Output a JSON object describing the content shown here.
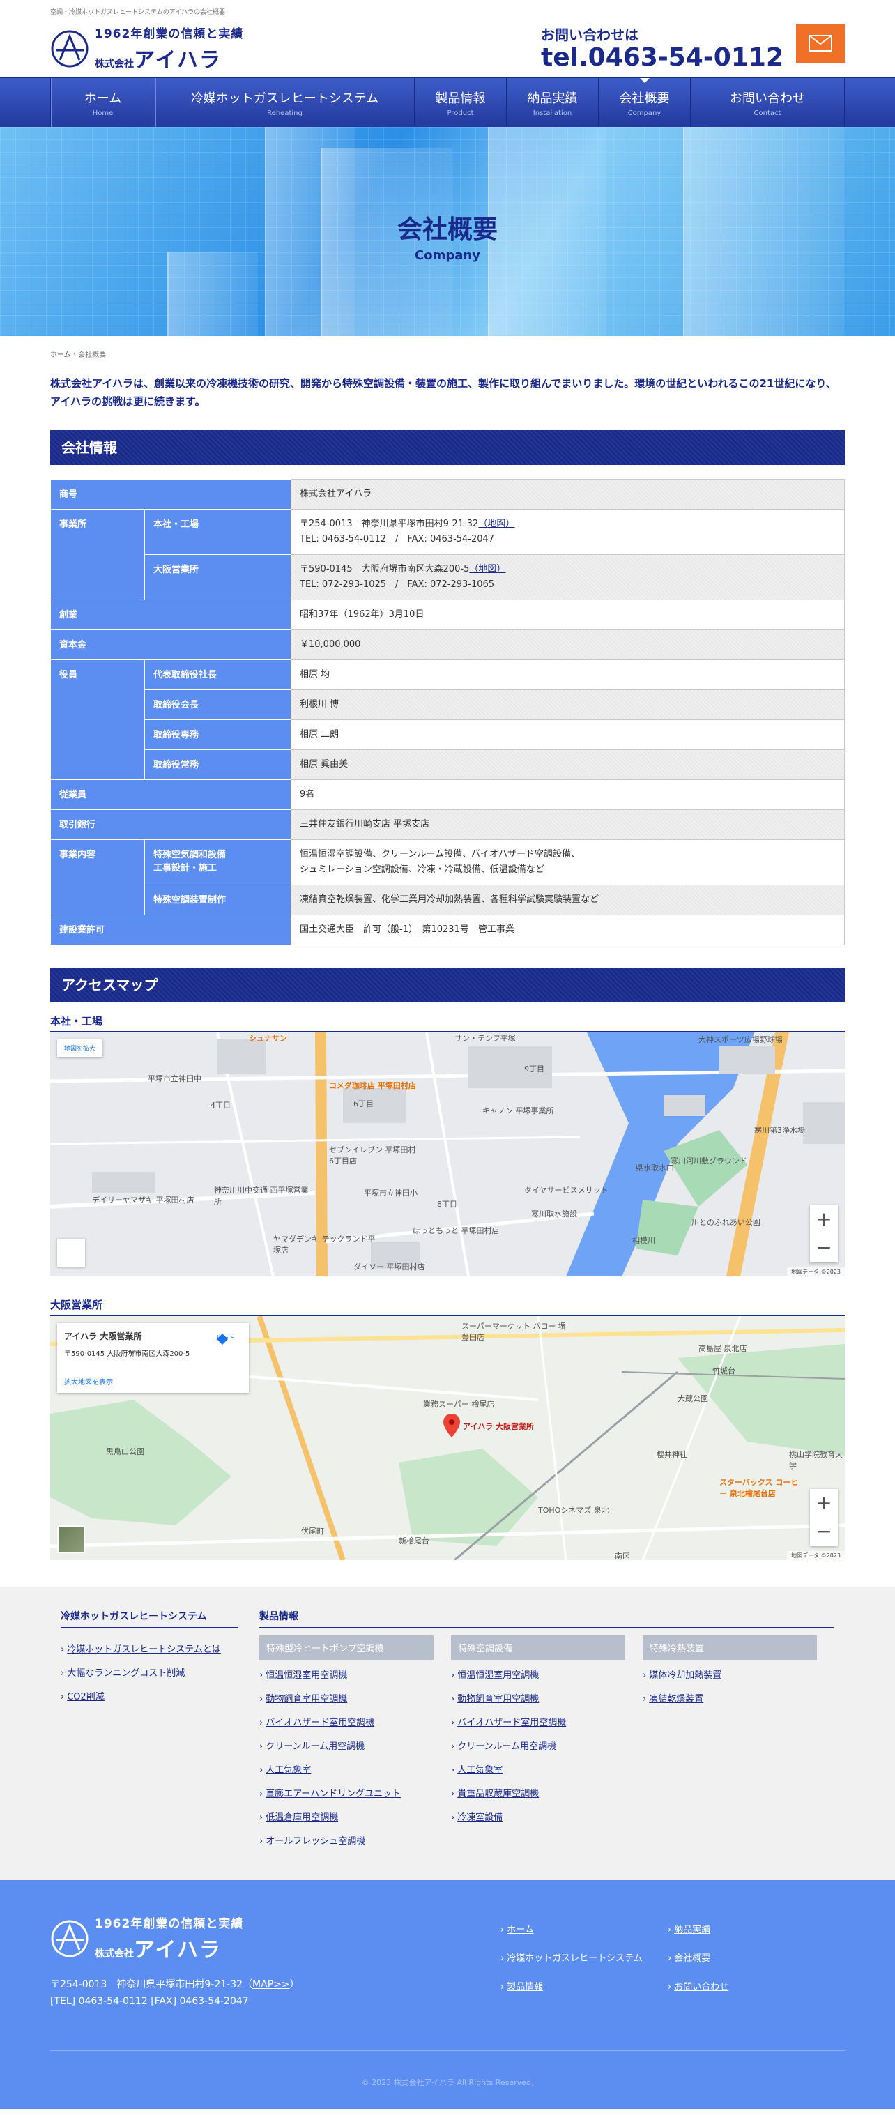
{
  "header": {
    "tagline": "空調・冷媒ホットガスレヒートシステムのアイハラの会社概要",
    "logo_line1": "1962年創業の信頼と実績",
    "logo_line2_prefix": "株式会社",
    "logo_line2_name": "アイハラ",
    "contact_label": "お問い合わせは",
    "contact_tel": "tel.0463-54-0112"
  },
  "nav": [
    {
      "jp": "ホーム",
      "en": "Home"
    },
    {
      "jp": "冷媒ホットガスレヒートシステム",
      "en": "Reheating"
    },
    {
      "jp": "製品情報",
      "en": "Product"
    },
    {
      "jp": "納品実績",
      "en": "Installation"
    },
    {
      "jp": "会社概要",
      "en": "Company"
    },
    {
      "jp": "お問い合わせ",
      "en": "Contact"
    }
  ],
  "hero": {
    "title": "会社概要",
    "subtitle": "Company"
  },
  "breadcrumb": {
    "home": "ホーム",
    "sep": "›",
    "current": "会社概要"
  },
  "lead": "株式会社アイハラは、創業以来の冷凍機技術の研究、開発から特殊空調設備・装置の施工、製作に取り組んでまいりました。環境の世紀といわれるこの21世紀になり、アイハラの挑戦は更に続きます。",
  "company_section_title": "会社情報",
  "company": {
    "name_h": "商号",
    "name_v": "株式会社アイハラ",
    "office_h": "事業所",
    "hq_h": "本社・工場",
    "hq_addr": "〒254-0013　神奈川県平塚市田村9-21-32",
    "map_link": "（地図）",
    "hq_tel": "TEL: 0463-54-0112　/　FAX: 0463-54-2047",
    "osaka_h": "大阪営業所",
    "osaka_addr": "〒590-0145　大阪府堺市南区大森200-5",
    "osaka_tel": "TEL: 072-293-1025　/　FAX: 072-293-1065",
    "founded_h": "創業",
    "founded_v": "昭和37年（1962年）3月10日",
    "capital_h": "資本金",
    "capital_v": "￥10,000,000",
    "officers_h": "役員",
    "officers": [
      {
        "role": "代表取締役社長",
        "name": "相原 均"
      },
      {
        "role": "取締役会長",
        "name": "利根川 博"
      },
      {
        "role": "取締役専務",
        "name": "相原 二朗"
      },
      {
        "role": "取締役常務",
        "name": "相原 眞由美"
      }
    ],
    "employees_h": "従業員",
    "employees_v": "9名",
    "bank_h": "取引銀行",
    "bank_v": "三井住友銀行川崎支店 平塚支店",
    "business_h": "事業内容",
    "biz1_h1": "特殊空気調和設備",
    "biz1_h2": "工事設計・施工",
    "biz1_v1": "恒温恒湿空調設備、クリーンルーム設備、バイオハザード空調設備、",
    "biz1_v2": "シュミレーション空調設備、冷凍・冷蔵設備、低温設備など",
    "biz2_h": "特殊空調装置制作",
    "biz2_v": "凍結真空乾燥装置、化学工業用冷却加熱装置、各種科学試験実験装置など",
    "license_h": "建設業許可",
    "license_v": "国土交通大臣　許可（般-1）　第10231号　管工事業"
  },
  "access_section_title": "アクセスマップ",
  "map1": {
    "label": "本社・工場",
    "ctrl": "地図を拡大",
    "places": [
      "シュナサン",
      "サン・テンプ平塚",
      "大神スポーツ広場野球場",
      "平塚市立神田中",
      "コメダ珈琲店 平塚田村店",
      "6丁目",
      "9丁目",
      "キャノン 平塚事業所",
      "寒川第3浄水場",
      "4丁目",
      "セブンイレブン 平塚田村6丁目店",
      "県水取水口",
      "寒川河川敷グラウンド",
      "神奈川川中交通 西平塚営業所",
      "平塚市立神田小",
      "8丁目",
      "タイヤサービスメリット",
      "寒川取水施設",
      "デイリーヤマザキ 平塚田村店",
      "ヤマダデンキ テックランド平塚店",
      "ほっともっと 平塚田村店",
      "ダイソー 平塚田村店",
      "川とのふれあい公園",
      "相模川"
    ],
    "copy": "地図データ ©2023"
  },
  "map2": {
    "label": "大阪営業所",
    "card_name": "アイハラ 大阪営業所",
    "card_addr": "〒590-0145 大阪府堺市南区大森200-5",
    "card_link": "拡大地図を表示",
    "card_dir": "ルート",
    "pin_label": "アイハラ 大阪営業所",
    "places": [
      "スーパーマーケット バロー 堺豊田店",
      "業務スーパー 檜尾店",
      "高島屋 泉北店",
      "黒鳥山公園",
      "櫻井神社",
      "スターバックス コーヒー 泉北檜尾台店",
      "TOHOシネマズ 泉北",
      "新檜尾台",
      "南区",
      "伏尾町",
      "竹城台",
      "大蔵公園",
      "桃山学院教育大学"
    ],
    "copy": "地図データ ©2023"
  },
  "footer_links": {
    "reheat_head": "冷媒ホットガスレヒートシステム",
    "reheat_items": [
      "冷媒ホットガスレヒートシステムとは",
      "大幅なランニングコスト削減",
      "CO2削減"
    ],
    "product_head": "製品情報",
    "cols": [
      {
        "head": "特殊型冷ヒートポンプ空調機",
        "items": [
          "恒温恒湿室用空調機",
          "動物飼育室用空調機",
          "バイオハザード室用空調機",
          "クリーンルーム用空調機",
          "人工気象室",
          "直膨エアーハンドリングユニット",
          "低温倉庫用空調機",
          "オールフレッシュ空調機"
        ]
      },
      {
        "head": "特殊空調設備",
        "items": [
          "恒温恒湿室用空調機",
          "動物飼育室用空調機",
          "バイオハザード室用空調機",
          "クリーンルーム用空調機",
          "人工気象室",
          "貴重品収蔵庫空調機",
          "冷凍室設備"
        ]
      },
      {
        "head": "特殊冷熱装置",
        "items": [
          "媒体冷却加熱装置",
          "凍結乾燥装置"
        ]
      }
    ]
  },
  "footer": {
    "address": "〒254-0013　神奈川県平塚市田村9-21-32（",
    "map_link": "MAP>>",
    "address_end": "）",
    "telfax": "[TEL] 0463-54-0112 [FAX] 0463-54-2047",
    "links": [
      "ホーム",
      "納品実績",
      "冷媒ホットガスレヒートシステム",
      "会社概要",
      "製品情報",
      "お問い合わせ"
    ],
    "copyright": "© 2023 株式会社アイハラ All Rights Reserved."
  },
  "colors": {
    "brand": "#1a2a8a",
    "table_head": "#5b8ef0",
    "accent": "#f07028",
    "footer_bg": "#5b8ef0"
  }
}
